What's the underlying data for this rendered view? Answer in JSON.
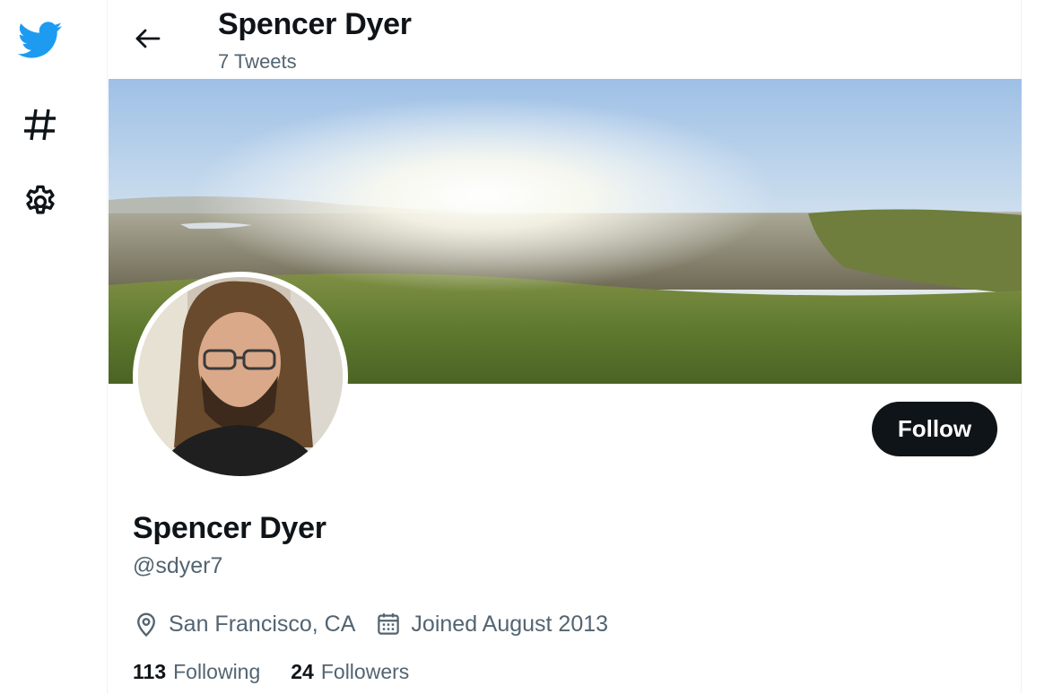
{
  "nav": {
    "items": [
      {
        "icon": "twitter-bird-icon",
        "color": "#1d9bf0"
      },
      {
        "icon": "hashtag-icon"
      },
      {
        "icon": "gear-icon"
      }
    ]
  },
  "header": {
    "name": "Spencer Dyer",
    "tweet_count": "7 Tweets"
  },
  "profile": {
    "display_name": "Spencer Dyer",
    "handle": "@sdyer7",
    "location": "San Francisco, CA",
    "joined": "Joined August 2013",
    "follow_label": "Follow",
    "following_count": "113",
    "following_label": "Following",
    "followers_count": "24",
    "followers_label": "Followers"
  },
  "colors": {
    "brand": "#1d9bf0",
    "text_primary": "#0f1419",
    "text_secondary": "#536471"
  }
}
